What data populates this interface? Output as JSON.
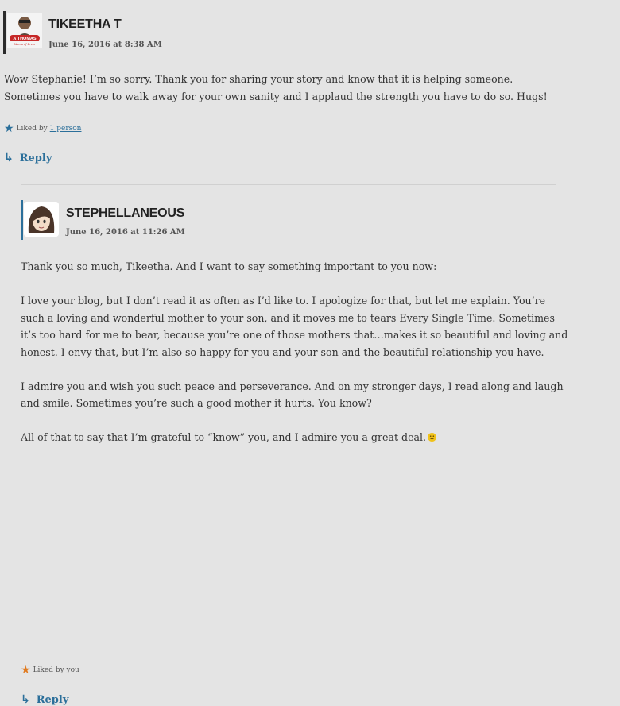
{
  "comments": [
    {
      "author": "TIKEETHA T",
      "date": "June 16, 2016 at 8:38 AM",
      "avatar_badge_top": "A THOMAS",
      "avatar_badge_bottom": "Mama of Drew",
      "paragraphs": [
        "Wow Stephanie! I’m so sorry. Thank you for sharing your story and know that it is helping someone. Sometimes you have to walk away for your own sanity and I applaud the strength you have to do so. Hugs!"
      ],
      "likes_prefix": "Liked by",
      "likes_link": "1 person",
      "likes_star_color": "#2b6f9a",
      "reply_label": "Reply"
    },
    {
      "author": "STEPHELLANEOUS",
      "date": "June 16, 2016 at 11:26 AM",
      "paragraphs": [
        "Thank you so much, Tikeetha. And I want to say something important to you now:",
        "I love your blog, but I don’t read it as often as I’d like to. I apologize for that, but let me explain. You’re such a loving and wonderful mother to your son, and it moves me to tears Every Single Time. Sometimes it’s too hard for me to bear, because you’re one of those mothers that…makes it so beautiful and loving and honest. I envy that, but I’m also so happy for you and your son and the beautiful relationship you have.",
        "I admire you and wish you such peace and perseverance. And on my stronger days, I read along and laugh and smile. Sometimes you’re such a good mother it hurts. You know?",
        "All of that to say that I’m grateful to “know” you, and I admire you a great deal."
      ],
      "likes_text": "Liked by you",
      "likes_star_color": "#e07a1f",
      "reply_label": "Reply"
    }
  ],
  "colors": {
    "background": "#e4e4e4",
    "link": "#2b6f9a",
    "text": "#333333"
  }
}
